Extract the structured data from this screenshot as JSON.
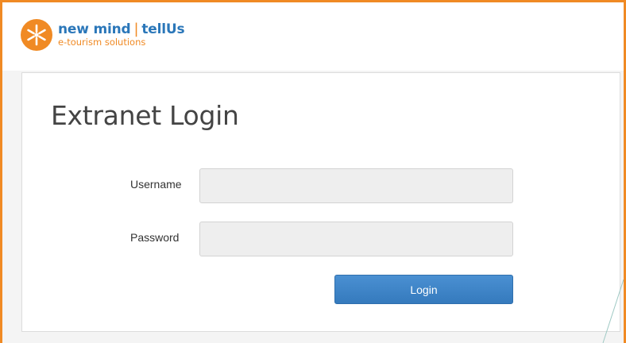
{
  "brand": {
    "name_left": "new mind",
    "separator": "|",
    "name_right": "tellUs",
    "tagline": "e-tourism solutions",
    "logo_icon": "snowflake-logo-icon"
  },
  "login": {
    "title": "Extranet Login",
    "username_label": "Username",
    "username_value": "",
    "password_label": "Password",
    "password_value": "",
    "button_label": "Login"
  },
  "colors": {
    "accent_orange": "#f08a24",
    "brand_blue": "#2b77b9",
    "button_blue": "#3b82c6"
  }
}
